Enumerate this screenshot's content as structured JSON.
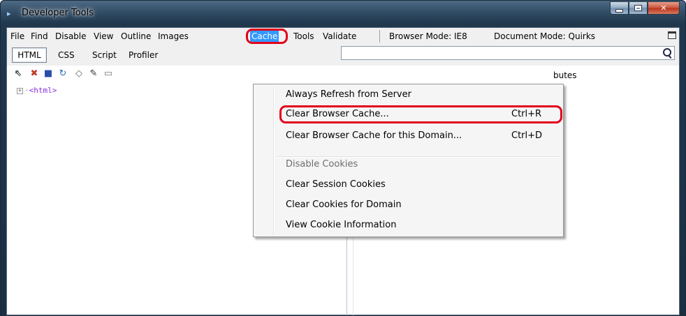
{
  "window": {
    "title": "Developer Tools"
  },
  "menubar": {
    "items": [
      "File",
      "Find",
      "Disable",
      "View",
      "Outline",
      "Images",
      "Cache",
      "Tools",
      "Validate"
    ],
    "browser_mode": "Browser Mode: IE8",
    "document_mode": "Document Mode: Quirks"
  },
  "tabs": [
    "HTML",
    "CSS",
    "Script",
    "Profiler"
  ],
  "right_pane": {
    "attributes_label": "butes"
  },
  "tree": {
    "root": "<html>"
  },
  "cache_menu": {
    "items": [
      {
        "label": "Always Refresh from Server",
        "shortcut": ""
      },
      {
        "label": "Clear Browser Cache...",
        "shortcut": "Ctrl+R"
      },
      {
        "label": "Clear Browser Cache for this Domain...",
        "shortcut": "Ctrl+D"
      },
      {
        "label": "Disable Cookies",
        "shortcut": ""
      },
      {
        "label": "Clear Session Cookies",
        "shortcut": ""
      },
      {
        "label": "Clear Cookies for Domain",
        "shortcut": ""
      },
      {
        "label": "View Cookie Information",
        "shortcut": ""
      }
    ]
  },
  "colors": {
    "highlight_ring": "#e3001b",
    "menu_selected": "#3399ff"
  }
}
